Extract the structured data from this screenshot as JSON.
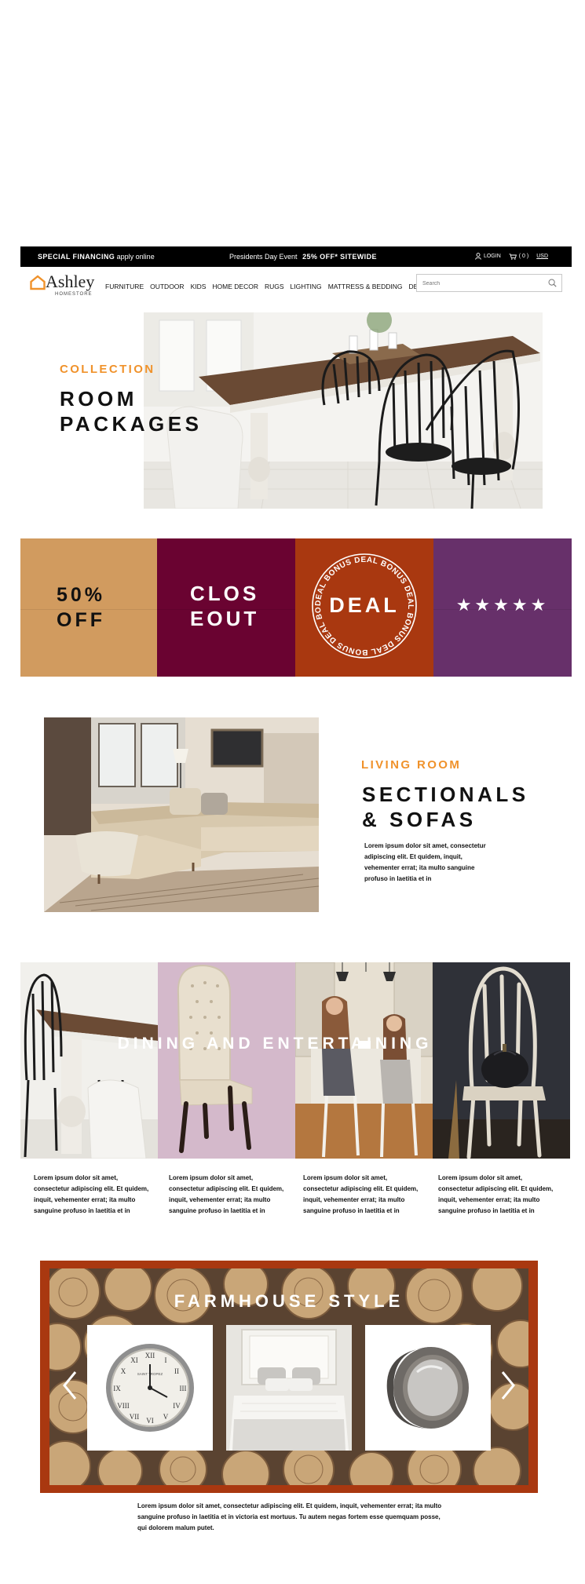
{
  "promo": {
    "financing_bold": "SPECIAL FINANCING",
    "financing_rest": "apply online",
    "event_prefix": "Presidents Day Event",
    "event_bold": "25% OFF* SITEWIDE",
    "login": "LOGIN",
    "cart_count": "( 0 )",
    "currency": "USD"
  },
  "brand": {
    "name": "Ashley",
    "sub": "HOMESTORE",
    "accent": "#f0922b"
  },
  "nav": {
    "items": [
      "FURNITURE",
      "OUTDOOR",
      "KIDS",
      "HOME DECOR",
      "RUGS",
      "LIGHTING",
      "MATTRESS & BEDDING",
      "DEALS"
    ],
    "search_placeholder": "Search"
  },
  "hero": {
    "kicker": "COLLECTION",
    "title_line1": "ROOM",
    "title_line2": "PACKAGES"
  },
  "deals": {
    "tile1_line1": "50%",
    "tile1_line2": "OFF",
    "tile2_line1": "CLOS",
    "tile2_line2": "EOUT",
    "tile3_label": "DEAL",
    "tile3_ring": "DEAL BONUS DEAL BONUS DEAL BONUS DEAL BONUS DEAL BONUS ",
    "tile4_stars": "★★★★★",
    "colors": [
      "#d19b5f",
      "#6a0331",
      "#a93810",
      "#67306a"
    ]
  },
  "living": {
    "kicker": "LIVING ROOM",
    "title_line1": "SECTIONALS",
    "title_line2": "& SOFAS",
    "body": "Lorem ipsum dolor sit amet, consectetur adipiscing elit. Et quidem, inquit, vehementer errat; ita multo sanguine profuso in laetitia et in"
  },
  "dining": {
    "title": "DINING AND ENTERTAINING",
    "texts": [
      "Lorem ipsum dolor sit amet, consectetur adipiscing elit. Et quidem, inquit, vehementer errat; ita multo sanguine profuso in laetitia et in",
      "Lorem ipsum dolor sit amet, consectetur adipiscing elit. Et quidem, inquit, vehementer errat; ita multo sanguine profuso in laetitia et in",
      "Lorem ipsum dolor sit amet, consectetur adipiscing elit. Et quidem, inquit, vehementer errat; ita multo sanguine profuso in laetitia et in",
      "Lorem ipsum dolor sit amet, consectetur adipiscing elit. Et quidem, inquit, vehementer errat; ita multo sanguine profuso in laetitia et in"
    ]
  },
  "farmhouse": {
    "title": "FARMHOUSE STYLE",
    "body": "Lorem ipsum dolor sit amet, consectetur adipiscing elit. Et quidem, inquit, vehementer errat; ita multo sanguine profuso in laetitia et in victoria est mortuus. Tu autem negas fortem esse quemquam posse, qui dolorem malum putet.",
    "clock_text": "SAINT TROPEZ"
  }
}
